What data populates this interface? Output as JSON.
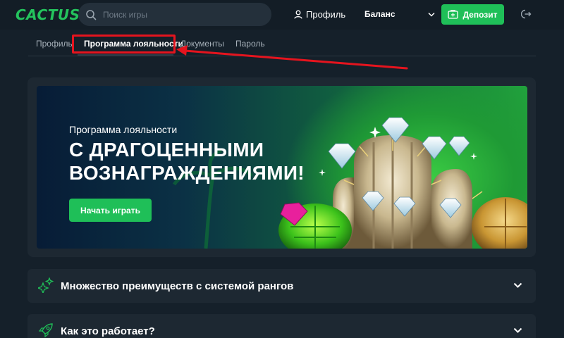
{
  "header": {
    "logo": "CACTUS",
    "search_placeholder": "Поиск игры",
    "profile_label": "Профиль",
    "balance_label": "Баланс",
    "deposit_label": "Депозит"
  },
  "tabs": [
    {
      "label": "Профиль",
      "active": false
    },
    {
      "label": "Программа лояльности",
      "active": true
    },
    {
      "label": "Документы",
      "active": false
    },
    {
      "label": "Пароль",
      "active": false
    }
  ],
  "banner": {
    "overline": "Программа лояльности",
    "title": "С ДРАГОЦЕННЫМИ ВОЗНАГРАЖДЕНИЯМИ!",
    "cta_label": "Начать играть"
  },
  "accordion": [
    {
      "label": "Множество преимуществ с системой рангов",
      "icon": "sparkles-icon"
    },
    {
      "label": "Как это работает?",
      "icon": "rocket-icon"
    }
  ],
  "colors": {
    "accent": "#1fbf58",
    "highlight": "#e5141e",
    "background": "#15202a"
  }
}
